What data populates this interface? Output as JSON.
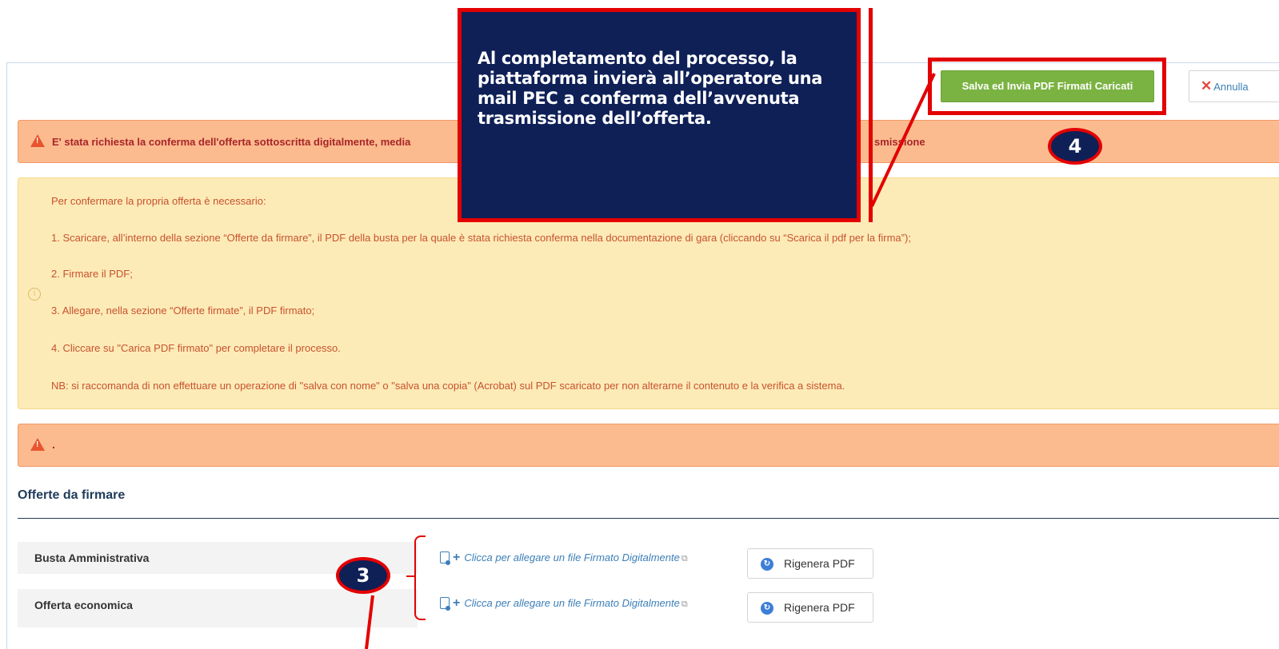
{
  "toolbar": {
    "save_label": "Salva ed Invia PDF Firmati Caricati",
    "cancel_label": "Annulla"
  },
  "alerts": {
    "top_text_left": "E' stata richiesta la conferma dell'offerta sottoscritta digitalmente, media",
    "top_text_right": "smissione",
    "second_text": "."
  },
  "info": {
    "lines": [
      "Per confermare la propria offerta è necessario:",
      "1. Scaricare, all’interno della sezione “Offerte da firmare”, il PDF della busta per la quale è stata richiesta conferma nella documentazione di gara (cliccando su “Scarica il pdf per la firma”);",
      "2. Firmare il PDF;",
      "3. Allegare, nella sezione “Offerte firmate”, il PDF firmato;",
      "4. Cliccare su \"Carica PDF firmato\" per completare il processo.",
      "NB: si raccomanda di non effettuare un operazione di \"salva con nome\" o \"salva una copia\" (Acrobat) sul PDF scaricato per non alterarne il contenuto e la verifica a sistema."
    ]
  },
  "section": {
    "title": "Offerte da firmare",
    "rows": [
      {
        "label": "Busta Amministrativa",
        "attach": "Clicca per allegare un file Firmato Digitalmente",
        "regen": "Rigenera PDF"
      },
      {
        "label": "Offerta economica",
        "attach": "Clicca per allegare un file Firmato Digitalmente",
        "regen": "Rigenera PDF"
      }
    ]
  },
  "annotation": {
    "callout_text": "Al completamento del processo, la piattaforma invierà all’operatore una mail PEC a conferma dell’avvenuta trasmissione dell’offerta.",
    "badge_4": "4",
    "badge_3": "3"
  },
  "colors": {
    "save_green": "#7bb342",
    "alert_orange": "#fbbb8e",
    "info_yellow": "#fdebb7",
    "annotation_navy": "#0f2057",
    "annotation_red": "#e30000"
  }
}
